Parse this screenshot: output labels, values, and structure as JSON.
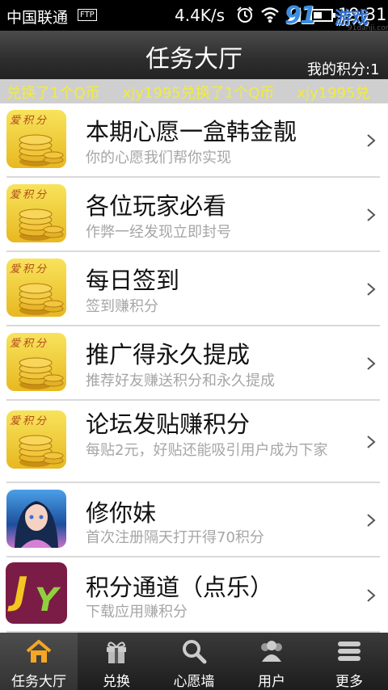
{
  "status_bar": {
    "carrier": "中国联通",
    "ftp_badge": "FTP",
    "speed": "4.4K/s",
    "time": "19:31",
    "icons": [
      "alarm-icon",
      "wifi-icon",
      "signal-icon",
      "battery-icon"
    ]
  },
  "watermark": {
    "main": "91",
    "sub": "游戏",
    "url": "91danji.com"
  },
  "header": {
    "title": "任务大厅",
    "points_label": "我的积分:1"
  },
  "marquee": {
    "segments": [
      "兑换了1个Q币",
      "xjy1995兑换了1个Q币",
      "xjy1995兑"
    ]
  },
  "tasks": [
    {
      "name": "本期心愿一盒韩金靓",
      "desc": "你的心愿我们帮你实现",
      "icon": "coins-icon",
      "thumb_label": "爱积分"
    },
    {
      "name": "各位玩家必看",
      "desc": "作弊一经发现立即封号",
      "icon": "coins-icon",
      "thumb_label": "爱积分"
    },
    {
      "name": "每日签到",
      "desc": "签到赚积分",
      "icon": "coins-icon",
      "thumb_label": "爱积分"
    },
    {
      "name": "推广得永久提成",
      "desc": "推荐好友赚送积分和永久提成",
      "icon": "coins-icon",
      "thumb_label": "爱积分"
    },
    {
      "name": "论坛发贴赚积分",
      "desc": "每贴2元，好贴还能吸引用户成为下家",
      "icon": "coins-icon",
      "thumb_label": "爱积分"
    },
    {
      "name": "修你妹",
      "desc": "首次注册隔天打开得70积分",
      "icon": "game-girl-icon"
    },
    {
      "name": "积分通道（点乐）",
      "desc": "下载应用赚积分",
      "icon": "jjy-logo-icon"
    }
  ],
  "bottom_nav": {
    "items": [
      {
        "label": "任务大厅",
        "icon": "home-icon",
        "active": true
      },
      {
        "label": "兑换",
        "icon": "gift-icon",
        "active": false
      },
      {
        "label": "心愿墙",
        "icon": "magnifier-icon",
        "active": false
      },
      {
        "label": "用户",
        "icon": "users-icon",
        "active": false
      },
      {
        "label": "更多",
        "icon": "menu-icon",
        "active": false
      }
    ]
  },
  "colors": {
    "marquee_text": "#f2ec3b",
    "header_bg": "#2d2d2d",
    "desc_text": "#a6a6a6",
    "active_tab_icon": "#f5a623"
  }
}
